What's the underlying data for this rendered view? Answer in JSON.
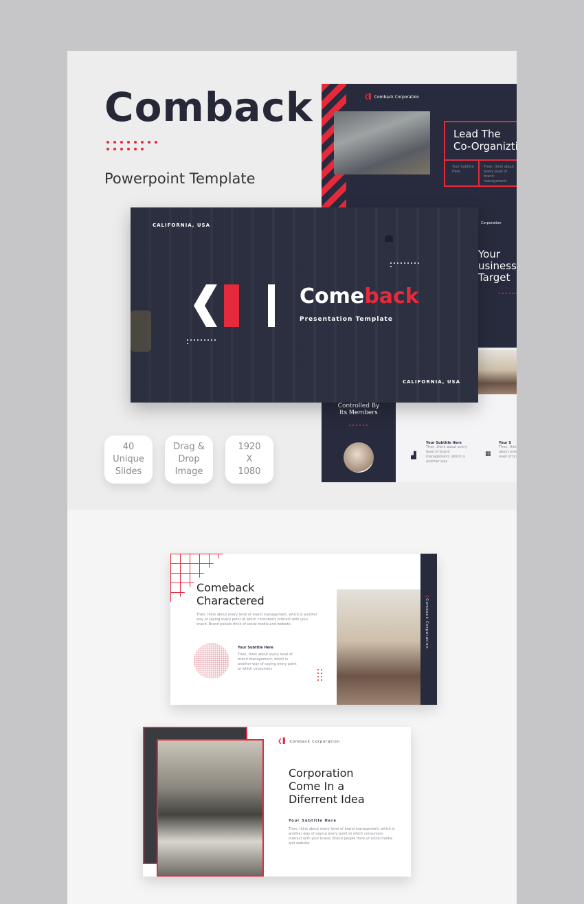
{
  "hero": {
    "title": "Comback",
    "subtitle": "Powerpoint Template"
  },
  "badges": [
    {
      "label": "40\nUnique\nSlides"
    },
    {
      "label": "Drag &\nDrop\nImage"
    },
    {
      "label": "1920\nX\n1080"
    }
  ],
  "slide_top_right": {
    "brand": "Comback Corporation",
    "heading_line1": "Lead The",
    "heading_line2": "Co-Organizti",
    "cell_left": "Your Subtitle Here",
    "cell_right": "Then, think about every level of brand management"
  },
  "slide_main": {
    "location_top": "CALIFORNIA, USA",
    "location_bottom": "CALIFORNIA, USA",
    "title_white": "Come",
    "title_red": "back",
    "tagline": "Presentation Template"
  },
  "slide_mid_right": {
    "brand": "Corporation",
    "heading_line1": "Your",
    "heading_line2": "usiness",
    "heading_line3": "Target"
  },
  "slide_bottom_right": {
    "heading_line1": "Controlled By",
    "heading_line2": "Its Members",
    "item1_title": "Your Subtitle Here",
    "item1_text": "Then, think about every level of brand management, which is another way",
    "item2_title": "Your S",
    "item2_text": "Then, think about every level of brand"
  },
  "slide_characterd": {
    "heading_line1": "Comeback",
    "heading_line2": "Charactered",
    "body": "Then, think about every level of brand management, which is another way of saying every point at which consumers interact with your brand. Brand people think of social media and website.",
    "subtitle": "Your Subtitle Here",
    "sub_body": "Then, think about every level of brand management, which is another way of saying every point at which consumers",
    "side_brand": "Comback Corporation"
  },
  "slide_corporation": {
    "brand": "Comback Corporation",
    "heading_line1": "Corporation",
    "heading_line2": "Come In a",
    "heading_line3": "Diferrent Idea",
    "subtitle": "Your Subtitle Here",
    "body": "Then, think about every level of brand management, which is another way of saying every point at which consumers interact with your brand. Brand people think of social media and website."
  },
  "colors": {
    "accent": "#e52a3c",
    "navy": "#282b3d",
    "background": "#c6c6c8"
  }
}
